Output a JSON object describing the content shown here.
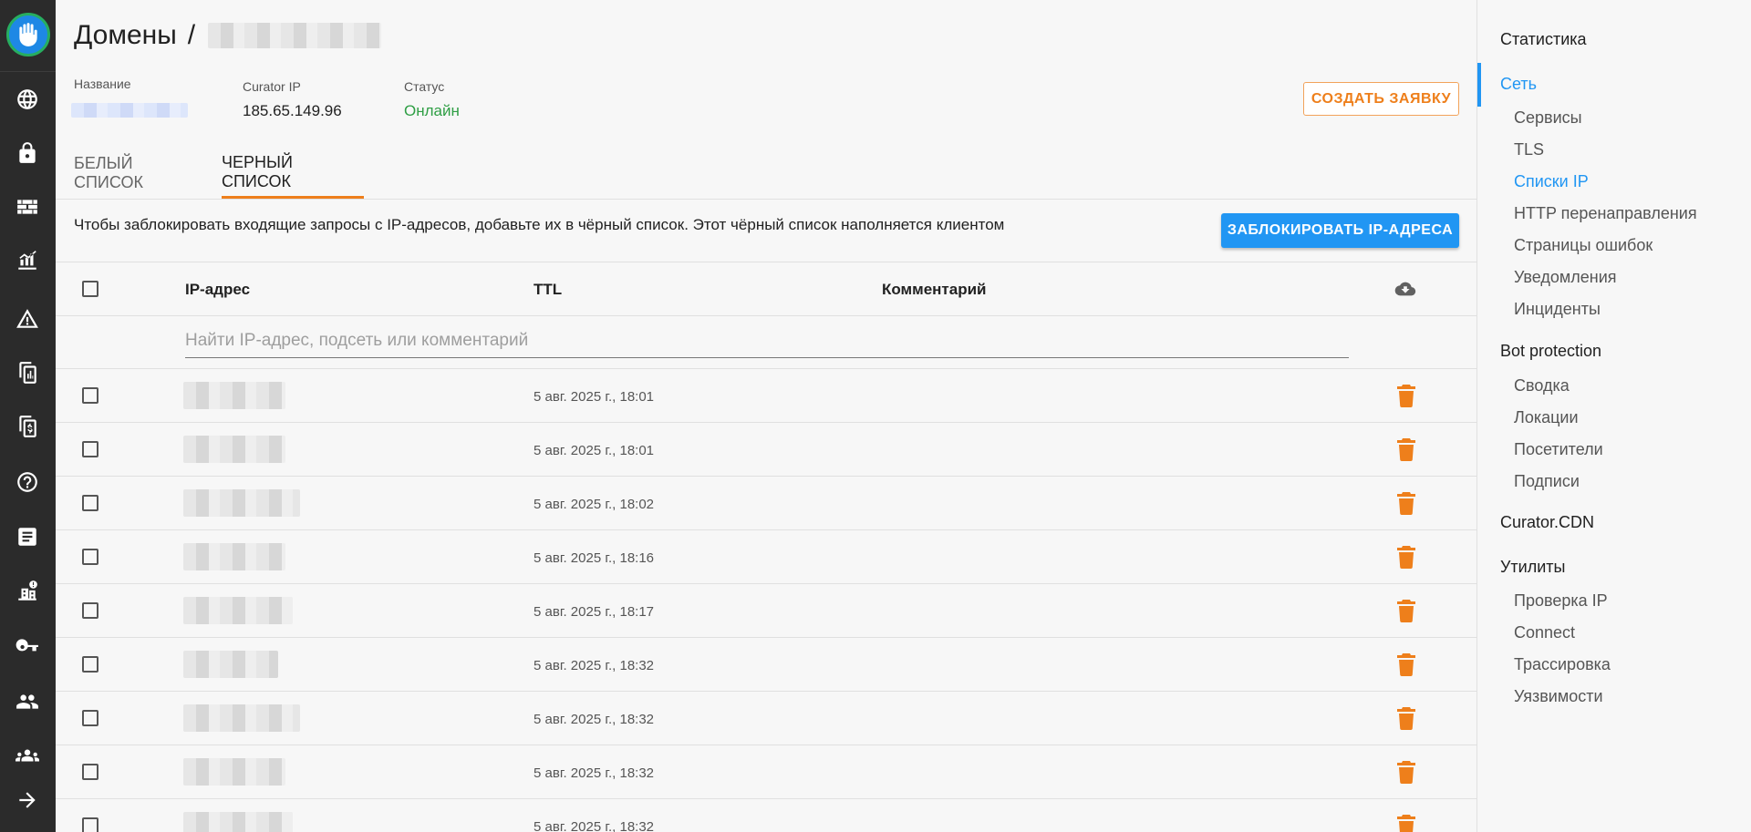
{
  "rail": {
    "logo_icon": "hand-shield-icon",
    "icons": [
      "globe-icon",
      "lock-icon",
      "firewall-icon",
      "analytics-icon",
      "warning-icon",
      "document-chart-icon",
      "invoice-icon",
      "help-icon",
      "article-icon",
      "domain-alert-icon",
      "key-icon",
      "group-icon",
      "team-icon",
      "arrow-right-icon"
    ]
  },
  "header": {
    "breadcrumb_root": "Домены",
    "breadcrumb_sep": "/"
  },
  "info": {
    "name_label": "Название",
    "curator_ip_label": "Curator IP",
    "curator_ip_value": "185.65.149.96",
    "status_label": "Статус",
    "status_value": "Онлайн"
  },
  "create_request_label": "СОЗДАТЬ ЗАЯВКУ",
  "tabs": [
    {
      "label": "БЕЛЫЙ СПИСОК",
      "active": false
    },
    {
      "label": "ЧЕРНЫЙ СПИСОК",
      "active": true
    }
  ],
  "description": "Чтобы заблокировать входящие запросы с IP-адресов, добавьте их в чёрный список. Этот чёрный список наполняется клиентом",
  "block_button_label": "ЗАБЛОКИРОВАТЬ IP-АДРЕСА",
  "table": {
    "columns": [
      "IP-адрес",
      "TTL",
      "Комментарий"
    ],
    "download_icon": "cloud-download-icon",
    "search_placeholder": "Найти IP-адрес, подсеть или комментарий",
    "rows": [
      {
        "ttl": "5 авг. 2025 г., 18:01"
      },
      {
        "ttl": "5 авг. 2025 г., 18:01"
      },
      {
        "ttl": "5 авг. 2025 г., 18:02"
      },
      {
        "ttl": "5 авг. 2025 г., 18:16"
      },
      {
        "ttl": "5 авг. 2025 г., 18:17"
      },
      {
        "ttl": "5 авг. 2025 г., 18:32"
      },
      {
        "ttl": "5 авг. 2025 г., 18:32"
      },
      {
        "ttl": "5 авг. 2025 г., 18:32"
      },
      {
        "ttl": "5 авг. 2025 г., 18:32"
      }
    ]
  },
  "right_nav": {
    "statistics": "Статистика",
    "network": "Сеть",
    "network_items": [
      "Сервисы",
      "TLS",
      "Списки IP",
      "HTTP перенаправления",
      "Страницы ошибок",
      "Уведомления",
      "Инциденты"
    ],
    "bot_protection": "Bot protection",
    "bot_items": [
      "Сводка",
      "Локации",
      "Посетители",
      "Подписи"
    ],
    "cdn": "Curator.CDN",
    "utilities": "Утилиты",
    "utility_items": [
      "Проверка IP",
      "Connect",
      "Трассировка",
      "Уязвимости"
    ]
  },
  "colors": {
    "accent_blue": "#2196f3",
    "accent_orange": "#ee7f1b",
    "status_green": "#2e9e44",
    "rail_bg": "#2b2b2b"
  }
}
